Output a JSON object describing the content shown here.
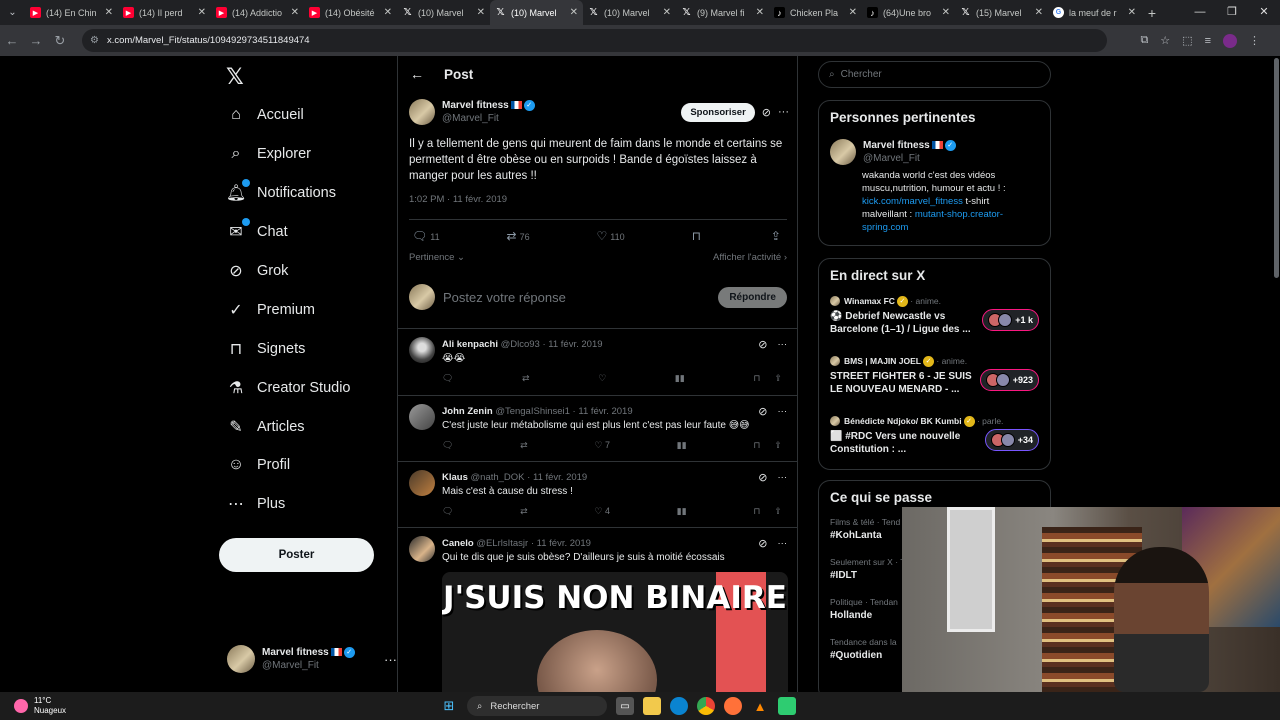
{
  "browser": {
    "tabs": [
      {
        "icon": "yt",
        "label": "(14) En Chin"
      },
      {
        "icon": "yt",
        "label": "(14) Il perd"
      },
      {
        "icon": "yt",
        "label": "(14) Addictio"
      },
      {
        "icon": "yt",
        "label": "(14) Obésité"
      },
      {
        "icon": "x",
        "label": "(10) Marvel"
      },
      {
        "icon": "x",
        "label": "(10) Marvel",
        "active": true
      },
      {
        "icon": "x",
        "label": "(10) Marvel"
      },
      {
        "icon": "x",
        "label": "(9) Marvel fi"
      },
      {
        "icon": "tt",
        "label": "Chicken Pla"
      },
      {
        "icon": "tt",
        "label": "(64)Une bro"
      },
      {
        "icon": "x",
        "label": "(15) Marvel"
      },
      {
        "icon": "g",
        "label": "la meuf de r"
      }
    ],
    "url": "x.com/Marvel_Fit/status/1094929734511849474"
  },
  "nav": {
    "items": [
      {
        "label": "Accueil",
        "icon": "home-icon"
      },
      {
        "label": "Explorer",
        "icon": "search-icon"
      },
      {
        "label": "Notifications",
        "icon": "bell-icon",
        "badge": true
      },
      {
        "label": "Chat",
        "icon": "mail-icon",
        "badge": true
      },
      {
        "label": "Grok",
        "icon": "grok-icon"
      },
      {
        "label": "Premium",
        "icon": "premium-icon"
      },
      {
        "label": "Signets",
        "icon": "bookmark-icon"
      },
      {
        "label": "Creator Studio",
        "icon": "flask-icon"
      },
      {
        "label": "Articles",
        "icon": "article-icon"
      },
      {
        "label": "Profil",
        "icon": "person-icon"
      },
      {
        "label": "Plus",
        "icon": "more-icon"
      }
    ],
    "post_button": "Poster",
    "account": {
      "name": "Marvel fitness",
      "handle": "@Marvel_Fit"
    }
  },
  "post": {
    "header_title": "Post",
    "author_name": "Marvel fitness",
    "author_handle": "@Marvel_Fit",
    "sponsor_label": "Sponsoriser",
    "text": "Il y a tellement de gens qui meurent de faim dans le monde et certains se permettent d être obèse ou en surpoids ! Bande d égoïstes laissez à manger pour les autres !!",
    "time": "1:02 PM · 11 févr. 2019",
    "replies": "11",
    "reposts": "76",
    "likes": "110",
    "sort_label": "Pertinence",
    "activity_label": "Afficher l'activité",
    "reply_placeholder": "Postez votre réponse",
    "reply_button": "Répondre"
  },
  "replies": [
    {
      "name": "Ali kenpachi",
      "handle": "@Dlco93",
      "date": "11 févr. 2019",
      "text": "😭😭",
      "likes": "",
      "avatar": "dark"
    },
    {
      "name": "John Zenin",
      "handle": "@TengaIShinsei1",
      "date": "11 févr. 2019",
      "text": "C'est juste leur métabolisme qui est plus lent c'est pas leur faute 😅😅",
      "likes": "7",
      "avatar": "grey"
    },
    {
      "name": "Klaus",
      "handle": "@nath_DOK",
      "date": "11 févr. 2019",
      "text": "Mais c'est à cause du stress !",
      "likes": "4",
      "avatar": "brown"
    },
    {
      "name": "Canelo",
      "handle": "@ELrlsItasjr",
      "date": "11 févr. 2019",
      "text": "Qui te dis que je suis obèse? D'ailleurs je suis à moitié écossais",
      "likes": "",
      "avatar": "face",
      "media_caption": "J'SUIS NON BINAIRE"
    }
  ],
  "right": {
    "search_placeholder": "Chercher",
    "relevant_title": "Personnes pertinentes",
    "relevant": {
      "name": "Marvel fitness",
      "handle": "@Marvel_Fit",
      "bio_text": "wakanda world c'est des vidéos muscu,nutrition, humour et actu ! :",
      "bio_link1": "kick.com/marvel_fitness",
      "bio_mid": " t-shirt malveillant : ",
      "bio_link2": "mutant-shop.creator-spring.com"
    },
    "live_title": "En direct sur X",
    "live": [
      {
        "source": "Winamax FC",
        "status": "anime.",
        "title": "⚽ Debrief Newcastle vs Barcelone (1–1) / Ligue des ...",
        "count": "+1 k",
        "pill": "pink"
      },
      {
        "source": "BMS | MAJIN JOEL",
        "status": "anime.",
        "title": "STREET FIGHTER 6 - JE SUIS LE NOUVEAU MENARD - ...",
        "count": "+923",
        "pill": "pink"
      },
      {
        "source": "Bénédicte Ndjoko/ BK Kumbi",
        "status": "parle.",
        "title": "⬜ #RDC Vers une nouvelle Constitution : ...",
        "count": "+34",
        "pill": "purple"
      }
    ],
    "happening_title": "Ce qui se passe",
    "trends": [
      {
        "category": "Films & télé · Tend",
        "tag": "#KohLanta"
      },
      {
        "category": "Seulement sur X · T",
        "tag": "#IDLT"
      },
      {
        "category": "Politique · Tendan",
        "tag": "Hollande"
      },
      {
        "category": "Tendance dans la",
        "tag": "#Quotidien"
      }
    ]
  },
  "taskbar": {
    "temperature": "11°C",
    "weather": "Nuageux",
    "search": "Rechercher"
  }
}
